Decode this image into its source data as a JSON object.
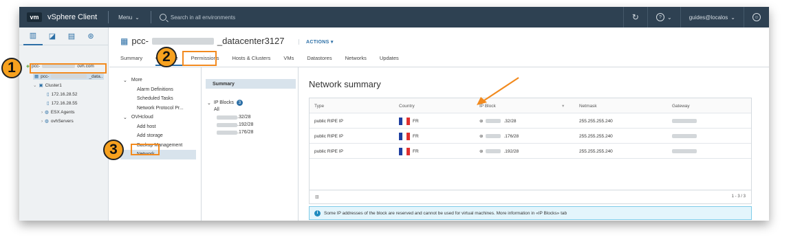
{
  "header": {
    "logo": "vm",
    "app_title": "vSphere Client",
    "menu_label": "Menu",
    "search_placeholder": "Search in all environments",
    "user_label": "guides@localos"
  },
  "sidebar": {
    "tree": {
      "root_prefix": "pcc-",
      "root_suffix": "ovh.com",
      "datacenter_prefix": "pcc-",
      "datacenter_suffix": "_data..",
      "cluster": "Cluster1",
      "host1": "172.16.28.52",
      "host2": "172.16.28.55",
      "folder1": "ESX Agents",
      "folder2": "ovhServers"
    }
  },
  "main": {
    "title_prefix": "pcc-",
    "title_suffix": "_datacenter3127",
    "actions_label": "ACTIONS",
    "tabs": [
      {
        "label": "Summary"
      },
      {
        "label": "Configure"
      },
      {
        "label": "Permissions"
      },
      {
        "label": "Hosts & Clusters"
      },
      {
        "label": "VMs"
      },
      {
        "label": "Datastores"
      },
      {
        "label": "Networks"
      },
      {
        "label": "Updates"
      }
    ],
    "config_menu": {
      "more_heading": "More",
      "more_items": [
        "Alarm Definitions",
        "Scheduled Tasks",
        "Network Protocol Pr..."
      ],
      "ovh_heading": "OVHcloud",
      "ovh_items": [
        "Add host",
        "Add storage",
        "Backup Management",
        "Network"
      ]
    },
    "subnav": {
      "summary": "Summary",
      "ip_blocks": "IP Blocks",
      "ip_blocks_count": "3",
      "all": "All",
      "blocks": [
        ".32/28",
        ".192/28",
        ".176/28"
      ]
    },
    "panel_title": "Network summary",
    "grid": {
      "headers": [
        "Type",
        "Country",
        "IP Block",
        "Netmask",
        "Gateway"
      ],
      "rows": [
        {
          "type": "public RIPE IP",
          "country": "FR",
          "ip_block": ".32/28",
          "netmask": "255.255.255.240"
        },
        {
          "type": "public RIPE IP",
          "country": "FR",
          "ip_block": ".176/28",
          "netmask": "255.255.255.240"
        },
        {
          "type": "public RIPE IP",
          "country": "FR",
          "ip_block": ".192/28",
          "netmask": "255.255.255.240"
        }
      ],
      "pagination": "1 - 3 / 3"
    },
    "info_message": "Some IP addresses of the block are reserved and cannot be used for virtual machines. More information in «IP Blocks» tab"
  },
  "annotations": {
    "step1": "1",
    "step2": "2",
    "step3": "3",
    "color": "#f28a1e"
  },
  "colors": {
    "header_bg": "#2e4152",
    "accent": "#2c6fa6",
    "highlight": "#f28a1e"
  }
}
